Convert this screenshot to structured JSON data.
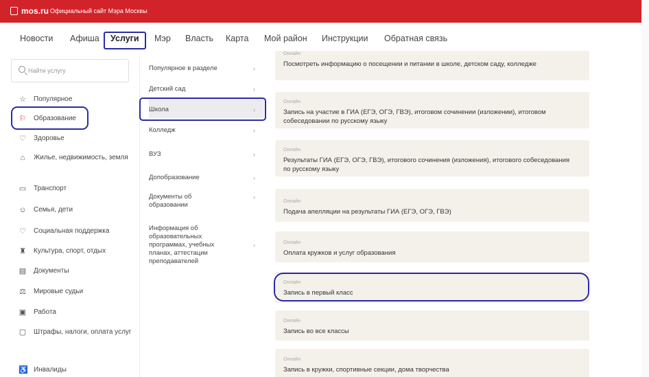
{
  "topbar": {
    "brand": "mos.ru",
    "subtitle": "Официальный сайт Мэра Москвы"
  },
  "nav": {
    "items": [
      "Новости",
      "Афиша",
      "Услуги",
      "Мэр",
      "Власть",
      "Карта",
      "Мой район",
      "Инструкции",
      "Обратная связь"
    ],
    "active": "Услуги"
  },
  "search": {
    "placeholder": "Найти услугу"
  },
  "categories": [
    {
      "label": "Популярное",
      "icon": "star-icon"
    },
    {
      "label": "Образование",
      "icon": "graduation-cap-icon",
      "active": true
    },
    {
      "label": "Здоровье",
      "icon": "health-icon"
    },
    {
      "label": "Жилье, недвижимость, земля",
      "icon": "home-icon"
    },
    {
      "label": "Транспорт",
      "icon": "bus-icon"
    },
    {
      "label": "Семья, дети",
      "icon": "family-icon"
    },
    {
      "label": "Социальная поддержка",
      "icon": "heart-icon"
    },
    {
      "label": "Культура, спорт, отдых",
      "icon": "theater-icon"
    },
    {
      "label": "Документы",
      "icon": "document-icon"
    },
    {
      "label": "Мировые судьи",
      "icon": "scales-icon"
    },
    {
      "label": "Работа",
      "icon": "briefcase-icon"
    },
    {
      "label": "Штрафы, налоги, оплата услуг",
      "icon": "receipt-icon"
    },
    {
      "label": "Инвалиды",
      "icon": "wheelchair-icon"
    }
  ],
  "subcategories": [
    {
      "label": "Популярное в разделе"
    },
    {
      "label": "Детский сад"
    },
    {
      "label": "Школа",
      "active": true
    },
    {
      "label": "Колледж"
    },
    {
      "label": "ВУЗ"
    },
    {
      "label": "Допобразование"
    },
    {
      "label": "Документы об образовании"
    },
    {
      "label": "Информация об образовательных программах, учебных планах, аттестации преподавателей"
    }
  ],
  "services": [
    {
      "tag": "Онлайн",
      "title": "Посмотреть информацию о посещении и питании в школе, детском саду, колледже"
    },
    {
      "tag": "Онлайн",
      "title": "Запись на участие в ГИА (ЕГЭ, ОГЭ, ГВЭ), итоговом сочинении (изложении), итоговом собеседовании по русскому языку"
    },
    {
      "tag": "Онлайн",
      "title": "Результаты ГИА (ЕГЭ, ОГЭ, ГВЭ), итогового сочинения (изложения), итогового собеседования по русскому языку"
    },
    {
      "tag": "Онлайн",
      "title": "Подача апелляции на результаты ГИА (ЕГЭ, ОГЭ, ГВЭ)"
    },
    {
      "tag": "Онлайн",
      "title": "Оплата кружков и услуг образования"
    },
    {
      "tag": "Онлайн",
      "title": "Запись в первый класс",
      "highlighted": true
    },
    {
      "tag": "Онлайн",
      "title": "Запись во все классы"
    },
    {
      "tag": "Онлайн",
      "title": "Запись в кружки, спортивные секции, дома творчества"
    }
  ],
  "colors": {
    "brand_red": "#d2232a",
    "annotation_blue": "#2a2ba4",
    "card_bg": "#f4f1ea"
  }
}
